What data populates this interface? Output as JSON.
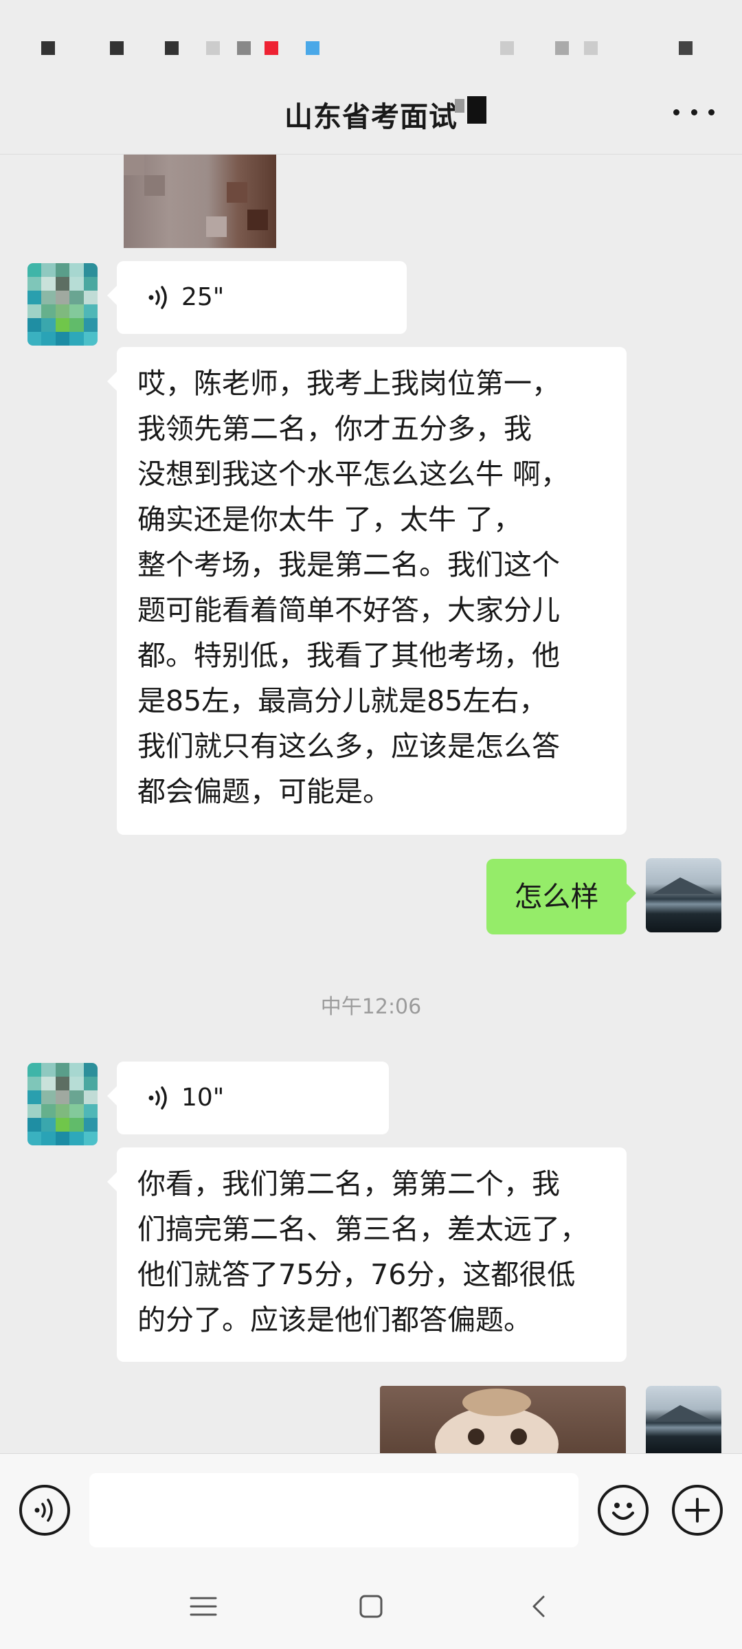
{
  "header": {
    "title": "山东省考面试",
    "more_icon": "more-icon"
  },
  "messages": {
    "voice1_duration": "25\"",
    "text1_lines": [
      "哎，陈老师，我考上我岗位第一，",
      "我领先第二名，你才五分多，我",
      "没想到我这个水平怎么这么牛 啊，",
      "确实还是你太牛 了，太牛 了，",
      "整个考场，我是第二名。我们这个",
      "题可能看着简单不好答，大家分儿",
      "都。特别低，我看了其他考场，他",
      "是85左，最高分儿就是85左右，",
      "我们就只有这么多，应该是怎么答",
      "都会偏题，可能是。"
    ],
    "sent1": "怎么样",
    "timestamp": "中午12:06",
    "voice2_duration": "10\"",
    "text2_lines": [
      "你看，我们第二名，第第二个，我",
      "们搞完第二名、第三名，差太远了，",
      "他们就答了75分，76分，这都很低",
      "的分了。应该是他们都答偏题。"
    ]
  },
  "input_bar": {
    "voice_button_icon": "voice-icon",
    "input_value": "",
    "emoji_button_icon": "emoji-icon",
    "add_button_icon": "plus-icon"
  },
  "nav": {
    "menu_icon": "menu-icon",
    "home_icon": "home-icon",
    "back_icon": "back-icon"
  },
  "colors": {
    "background": "#ededed",
    "sent_bubble": "#95ec69",
    "received_bubble": "#ffffff"
  }
}
